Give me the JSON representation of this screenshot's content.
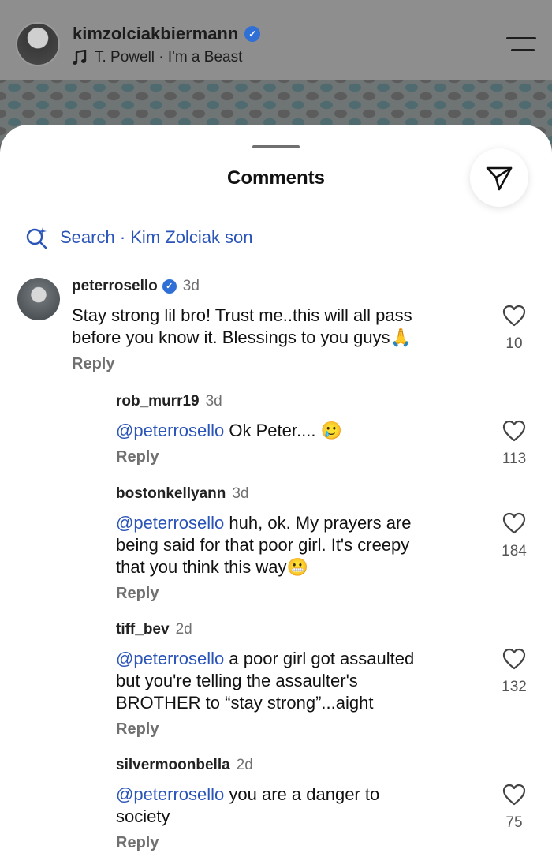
{
  "reel": {
    "username": "kimzolciakbiermann",
    "music": "T. Powell · I'm a Beast"
  },
  "sheet": {
    "title": "Comments",
    "search": "Search · Kim Zolciak son"
  },
  "comments": [
    {
      "username": "peterrosello",
      "verified": true,
      "time": "3d",
      "mention": "",
      "lines": [
        "Stay strong lil bro! Trust me..this will all pass",
        "before you know it. Blessings to you guys🙏"
      ],
      "reply": "Reply",
      "likes": "10"
    },
    {
      "username": "rob_murr19",
      "time": "3d",
      "mention": "@peterrosello",
      "lines": [
        " Ok Peter.... 🥲"
      ],
      "reply": "Reply",
      "likes": "113"
    },
    {
      "username": "bostonkellyann",
      "time": "3d",
      "mention": "@peterrosello",
      "lines": [
        " huh, ok. My prayers are",
        "being said for that poor girl. It's creepy",
        "that you think this way😬"
      ],
      "reply": "Reply",
      "likes": "184"
    },
    {
      "username": "tiff_bev",
      "time": "2d",
      "mention": "@peterrosello",
      "lines": [
        " a poor girl got assaulted",
        "but you're telling the assaulter's",
        "BROTHER to “stay strong”...aight"
      ],
      "reply": "Reply",
      "likes": "132"
    },
    {
      "username": "silvermoonbella",
      "time": "2d",
      "mention": "@peterrosello",
      "lines": [
        " you are a danger to",
        "society"
      ],
      "reply": "Reply",
      "likes": "75"
    }
  ],
  "icons": {
    "verified": "verified-badge-icon",
    "music": "music-note-icon",
    "menu": "menu-icon",
    "share": "paper-plane-icon",
    "search": "search-sparkle-icon",
    "like": "heart-outline-icon"
  },
  "colors": {
    "link": "#2a54b8",
    "verified": "#2f6fd6",
    "muted": "#707070"
  }
}
